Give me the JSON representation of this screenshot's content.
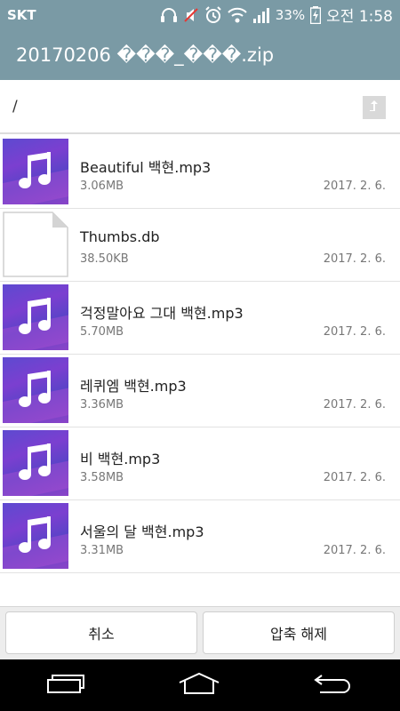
{
  "status_bar": {
    "carrier": "SKT",
    "battery_percent": "33%",
    "time": "오전 1:58",
    "icons": [
      "headset-icon",
      "mute-icon",
      "alarm-icon",
      "wifi-icon",
      "signal-icon",
      "battery-charging-icon"
    ]
  },
  "app_bar": {
    "title": "20170206 ���_���.zip"
  },
  "path_bar": {
    "path": "/",
    "up_icon": "up-folder-icon"
  },
  "files": [
    {
      "name": "Beautiful 백현.mp3",
      "size": "3.06MB",
      "date": "2017. 2. 6.",
      "type": "audio"
    },
    {
      "name": "Thumbs.db",
      "size": "38.50KB",
      "date": "2017. 2. 6.",
      "type": "document"
    },
    {
      "name": "걱정말아요 그대 백현.mp3",
      "size": "5.70MB",
      "date": "2017. 2. 6.",
      "type": "audio"
    },
    {
      "name": "레퀴엠 백현.mp3",
      "size": "3.36MB",
      "date": "2017. 2. 6.",
      "type": "audio"
    },
    {
      "name": "비 백현.mp3",
      "size": "3.58MB",
      "date": "2017. 2. 6.",
      "type": "audio"
    },
    {
      "name": "서울의 달 백현.mp3",
      "size": "3.31MB",
      "date": "2017. 2. 6.",
      "type": "audio"
    }
  ],
  "actions": {
    "cancel_label": "취소",
    "extract_label": "압축 해제"
  },
  "nav": {
    "icons": [
      "recent-apps-icon",
      "home-icon",
      "back-icon"
    ]
  },
  "colors": {
    "header": "#7a9aa5",
    "thumb_purple": "#6a45cf"
  }
}
